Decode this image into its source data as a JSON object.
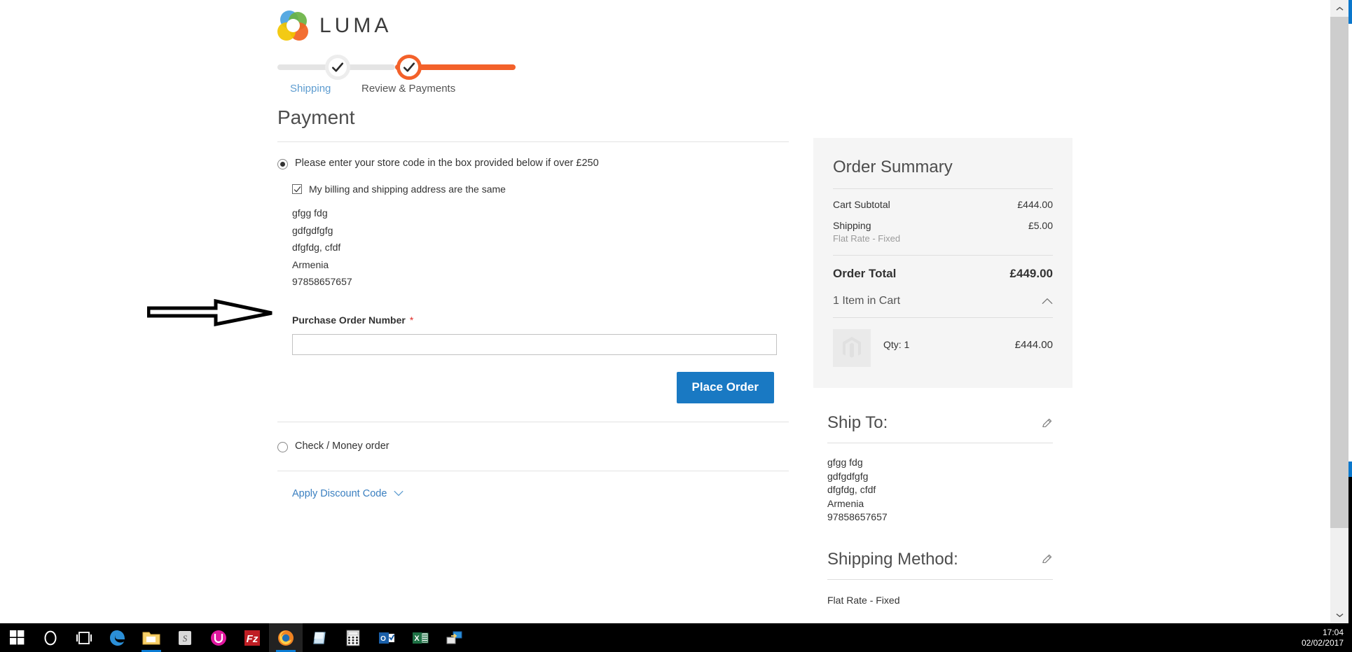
{
  "brand": {
    "name": "LUMA",
    "logo_icon": "luma-logo-icon"
  },
  "progress": {
    "steps": [
      {
        "label": "Shipping",
        "state": "complete",
        "icon": "check-icon"
      },
      {
        "label": "Review & Payments",
        "state": "current",
        "icon": "check-icon"
      }
    ]
  },
  "payment": {
    "title": "Payment",
    "methods": [
      {
        "label": "Please enter your store code in the box provided below if over £250",
        "selected": true
      },
      {
        "label": "Check / Money order",
        "selected": false
      }
    ],
    "billing_same_label": "My billing and shipping address are the same",
    "billing_same_checked": true,
    "billing_address": [
      "gfgg fdg",
      "gdfgdfgfg",
      "dfgfdg, cfdf",
      "Armenia",
      "97858657657"
    ],
    "po_label": "Purchase Order Number",
    "po_required_marker": "*",
    "po_value": "",
    "po_placeholder": "",
    "place_order_label": "Place Order",
    "discount_label": "Apply Discount Code",
    "discount_icon": "chevron-down-icon"
  },
  "order_summary": {
    "title": "Order Summary",
    "rows": [
      {
        "label": "Cart Subtotal",
        "sub": "",
        "value": "£444.00"
      },
      {
        "label": "Shipping",
        "sub": "Flat Rate - Fixed",
        "value": "£5.00"
      }
    ],
    "total_label": "Order Total",
    "total_value": "£449.00",
    "cart_header": "1 Item in Cart",
    "cart_toggle_icon": "chevron-up-icon",
    "item": {
      "thumb_icon": "magento-placeholder-icon",
      "qty_label": "Qty: 1",
      "price": "£444.00"
    }
  },
  "ship_to": {
    "title": "Ship To:",
    "edit_icon": "pencil-icon",
    "address": [
      "gfgg fdg",
      "gdfgdfgfg",
      "dfgfdg, cfdf",
      "Armenia",
      "97858657657"
    ]
  },
  "shipping_method": {
    "title": "Shipping Method:",
    "edit_icon": "pencil-icon",
    "value": "Flat Rate - Fixed"
  },
  "annotation": {
    "arrow_icon": "hollow-right-arrow-icon"
  },
  "colors": {
    "accent_orange": "#f3612a",
    "link_blue": "#3a7fc0",
    "button_blue": "#1979c3",
    "required_red": "#e02b27",
    "summary_bg": "#f5f5f5"
  },
  "taskbar": {
    "items": [
      {
        "name": "start-button",
        "icon": "windows-logo-icon"
      },
      {
        "name": "cortana-button",
        "icon": "circle-icon"
      },
      {
        "name": "task-view-button",
        "icon": "task-view-icon"
      },
      {
        "name": "edge-button",
        "icon": "edge-icon"
      },
      {
        "name": "file-explorer-button",
        "icon": "folder-icon"
      },
      {
        "name": "sublime-button",
        "icon": "sublime-icon"
      },
      {
        "name": "app-magenta-button",
        "icon": "magenta-app-icon"
      },
      {
        "name": "filezilla-button",
        "icon": "filezilla-icon"
      },
      {
        "name": "firefox-button",
        "icon": "firefox-icon"
      },
      {
        "name": "notes-button",
        "icon": "notes-icon"
      },
      {
        "name": "calculator-button",
        "icon": "calculator-icon"
      },
      {
        "name": "outlook-button",
        "icon": "outlook-icon"
      },
      {
        "name": "excel-button",
        "icon": "excel-icon"
      },
      {
        "name": "remote-button",
        "icon": "remote-desktop-icon"
      }
    ],
    "clock": {
      "time": "17:04",
      "date": "02/02/2017"
    }
  }
}
